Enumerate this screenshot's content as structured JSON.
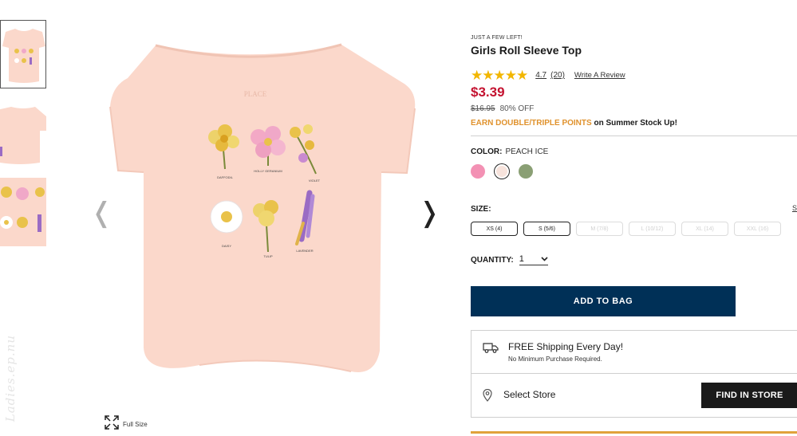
{
  "product": {
    "kicker": "JUST A FEW LEFT!",
    "title": "Girls Roll Sleeve Top",
    "rating": {
      "stars": "★★★★★",
      "value": "4.7",
      "count": "(20)",
      "write_review": "Write A Review"
    },
    "price": "$3.39",
    "original_price": "$16.95",
    "discount": "80% OFF",
    "points_highlight": "EARN DOUBLE/TRIPLE POINTS",
    "points_text": " on Summer Stock Up!",
    "color_label": "COLOR:",
    "color_value": "PEACH ICE",
    "swatches": [
      {
        "name": "pink",
        "hex": "#f391b4"
      },
      {
        "name": "peach-ice",
        "hex": "#f7e3dc",
        "selected": true
      },
      {
        "name": "sage",
        "hex": "#8a9f74"
      }
    ],
    "size_label": "SIZE:",
    "size_guide": "S",
    "sizes": [
      {
        "label": "XS (4)",
        "available": true
      },
      {
        "label": "S (5/6)",
        "available": true
      },
      {
        "label": "M (7/8)",
        "available": false
      },
      {
        "label": "L (10/12)",
        "available": false
      },
      {
        "label": "XL (14)",
        "available": false
      },
      {
        "label": "XXL (16)",
        "available": false
      }
    ],
    "quantity_label": "QUANTITY:",
    "quantity_value": "1",
    "add_to_bag": "ADD TO BAG",
    "shipping_title": "FREE Shipping Every Day!",
    "shipping_sub": "No Minimum Purchase Required.",
    "store_label": "Select Store",
    "find_in_store": "FIND IN STORE"
  },
  "gallery": {
    "full_size": "Full Size",
    "prev_arrow": "❬",
    "next_arrow": "❭",
    "watermark": "Ladies.ep.nu",
    "shirt_brand": "PLACE",
    "flower_labels": [
      "DAFFODIL",
      "HOLLY GERANIUM",
      "VIOLET",
      "DAISY",
      "TULIP",
      "LAVENDER"
    ]
  },
  "colors": {
    "price_red": "#c41230",
    "navy": "#003057",
    "gold": "#e0a23a",
    "shirt": "#fbd8cb"
  }
}
